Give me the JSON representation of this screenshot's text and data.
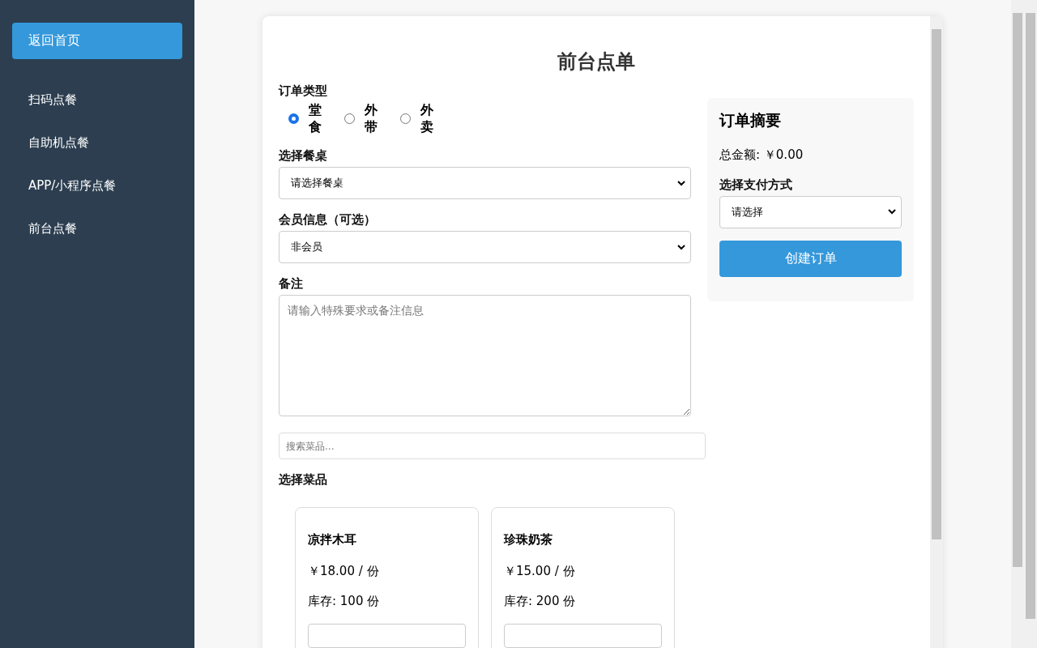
{
  "sidebar": {
    "home_button": "返回首页",
    "items": [
      {
        "label": "扫码点餐",
        "selected": false
      },
      {
        "label": "自助机点餐",
        "selected": false
      },
      {
        "label": "APP/小程序点餐",
        "selected": false
      },
      {
        "label": "前台点餐",
        "selected": false
      }
    ]
  },
  "title": "前台点单",
  "order_type": {
    "label": "订单类型",
    "options": [
      {
        "label": "堂食",
        "selected": true
      },
      {
        "label": "外带",
        "selected": false
      },
      {
        "label": "外卖",
        "selected": false
      }
    ]
  },
  "table_select": {
    "label": "选择餐桌",
    "value": "请选择餐桌"
  },
  "member_select": {
    "label": "会员信息（可选）",
    "value": "非会员"
  },
  "remarks": {
    "label": "备注",
    "placeholder": "请输入特殊要求或备注信息"
  },
  "search": {
    "placeholder": "搜索菜品..."
  },
  "dishes": {
    "label": "选择菜品",
    "items": [
      {
        "name": "凉拌木耳",
        "price": "￥18.00 / 份",
        "stock": "库存: 100 份"
      },
      {
        "name": "珍珠奶茶",
        "price": "￥15.00 / 份",
        "stock": "库存: 200 份"
      }
    ]
  },
  "summary": {
    "title": "订单摘要",
    "total": "总金额: ￥0.00",
    "payment_label": "选择支付方式",
    "payment_value": "请选择",
    "submit": "创建订单"
  }
}
